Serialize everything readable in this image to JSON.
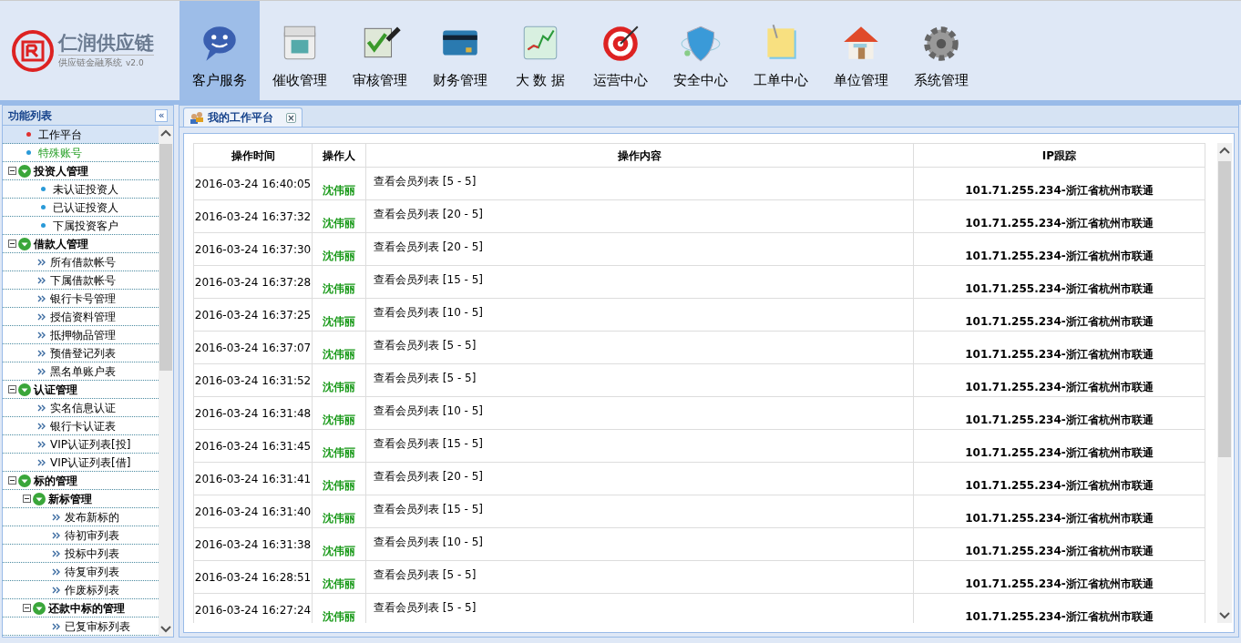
{
  "logo": {
    "title": "仁润供应链",
    "subtitle": "供应链金融系统",
    "version": "v2.0"
  },
  "nav": [
    {
      "label": "客户服务",
      "selected": true
    },
    {
      "label": "催收管理",
      "selected": false
    },
    {
      "label": "审核管理",
      "selected": false
    },
    {
      "label": "财务管理",
      "selected": false
    },
    {
      "label": "大 数 据",
      "selected": false
    },
    {
      "label": "运营中心",
      "selected": false
    },
    {
      "label": "安全中心",
      "selected": false
    },
    {
      "label": "工单中心",
      "selected": false
    },
    {
      "label": "单位管理",
      "selected": false
    },
    {
      "label": "系统管理",
      "selected": false
    }
  ],
  "sidebar": {
    "title": "功能列表",
    "collapse": "«",
    "items": [
      {
        "kind": "dot",
        "label": "工作平台",
        "color": "#e03030",
        "selected": true,
        "highlighted": false
      },
      {
        "kind": "dot",
        "label": "特殊账号",
        "color": "#2a9ad8",
        "selected": false,
        "highlighted": true
      },
      {
        "kind": "group",
        "label": "投资人管理",
        "expanded": true,
        "children": [
          {
            "kind": "dot",
            "label": "未认证投资人",
            "color": "#2a9ad8",
            "selected": false,
            "highlighted": false
          },
          {
            "kind": "dot",
            "label": "已认证投资人",
            "color": "#2a9ad8",
            "selected": false,
            "highlighted": false
          },
          {
            "kind": "dot",
            "label": "下属投资客户",
            "color": "#2a9ad8",
            "selected": false,
            "highlighted": false
          }
        ]
      },
      {
        "kind": "group",
        "label": "借款人管理",
        "expanded": true,
        "children": [
          {
            "kind": "link",
            "label": "所有借款帐号"
          },
          {
            "kind": "link",
            "label": "下属借款帐号"
          },
          {
            "kind": "link",
            "label": "银行卡号管理"
          },
          {
            "kind": "link",
            "label": "授信资料管理"
          },
          {
            "kind": "link",
            "label": "抵押物品管理"
          },
          {
            "kind": "link",
            "label": "预借登记列表"
          },
          {
            "kind": "link",
            "label": "黑名单账户表"
          }
        ]
      },
      {
        "kind": "group",
        "label": "认证管理",
        "expanded": true,
        "children": [
          {
            "kind": "link",
            "label": "实名信息认证"
          },
          {
            "kind": "link",
            "label": "银行卡认证表"
          },
          {
            "kind": "link",
            "label": "VIP认证列表[投]"
          },
          {
            "kind": "link",
            "label": "VIP认证列表[借]"
          }
        ]
      },
      {
        "kind": "group",
        "label": "标的管理",
        "expanded": true,
        "children": [
          {
            "kind": "group",
            "label": "新标管理",
            "expanded": true,
            "children": [
              {
                "kind": "link",
                "label": "发布新标的"
              },
              {
                "kind": "link",
                "label": "待初审列表"
              },
              {
                "kind": "link",
                "label": "投标中列表"
              },
              {
                "kind": "link",
                "label": "待复审列表"
              },
              {
                "kind": "link",
                "label": "作废标列表"
              }
            ]
          },
          {
            "kind": "group",
            "label": "还款中标的管理",
            "expanded": true,
            "children": [
              {
                "kind": "link",
                "label": "已复审标列表"
              }
            ]
          }
        ]
      }
    ]
  },
  "tab": {
    "label": "我的工作平台",
    "close": "×"
  },
  "table": {
    "columns": [
      "操作时间",
      "操作人",
      "操作内容",
      "IP跟踪"
    ],
    "rows": [
      [
        "2016-03-24 16:40:05",
        "沈伟丽",
        "查看会员列表 [5 - 5]",
        "101.71.255.234-浙江省杭州市联通"
      ],
      [
        "2016-03-24 16:37:32",
        "沈伟丽",
        "查看会员列表 [20 - 5]",
        "101.71.255.234-浙江省杭州市联通"
      ],
      [
        "2016-03-24 16:37:30",
        "沈伟丽",
        "查看会员列表 [20 - 5]",
        "101.71.255.234-浙江省杭州市联通"
      ],
      [
        "2016-03-24 16:37:28",
        "沈伟丽",
        "查看会员列表 [15 - 5]",
        "101.71.255.234-浙江省杭州市联通"
      ],
      [
        "2016-03-24 16:37:25",
        "沈伟丽",
        "查看会员列表 [10 - 5]",
        "101.71.255.234-浙江省杭州市联通"
      ],
      [
        "2016-03-24 16:37:07",
        "沈伟丽",
        "查看会员列表 [5 - 5]",
        "101.71.255.234-浙江省杭州市联通"
      ],
      [
        "2016-03-24 16:31:52",
        "沈伟丽",
        "查看会员列表 [5 - 5]",
        "101.71.255.234-浙江省杭州市联通"
      ],
      [
        "2016-03-24 16:31:48",
        "沈伟丽",
        "查看会员列表 [10 - 5]",
        "101.71.255.234-浙江省杭州市联通"
      ],
      [
        "2016-03-24 16:31:45",
        "沈伟丽",
        "查看会员列表 [15 - 5]",
        "101.71.255.234-浙江省杭州市联通"
      ],
      [
        "2016-03-24 16:31:41",
        "沈伟丽",
        "查看会员列表 [20 - 5]",
        "101.71.255.234-浙江省杭州市联通"
      ],
      [
        "2016-03-24 16:31:40",
        "沈伟丽",
        "查看会员列表 [15 - 5]",
        "101.71.255.234-浙江省杭州市联通"
      ],
      [
        "2016-03-24 16:31:38",
        "沈伟丽",
        "查看会员列表 [10 - 5]",
        "101.71.255.234-浙江省杭州市联通"
      ],
      [
        "2016-03-24 16:28:51",
        "沈伟丽",
        "查看会员列表 [5 - 5]",
        "101.71.255.234-浙江省杭州市联通"
      ],
      [
        "2016-03-24 16:27:24",
        "沈伟丽",
        "查看会员列表 [5 - 5]",
        "101.71.255.234-浙江省杭州市联通"
      ]
    ]
  }
}
